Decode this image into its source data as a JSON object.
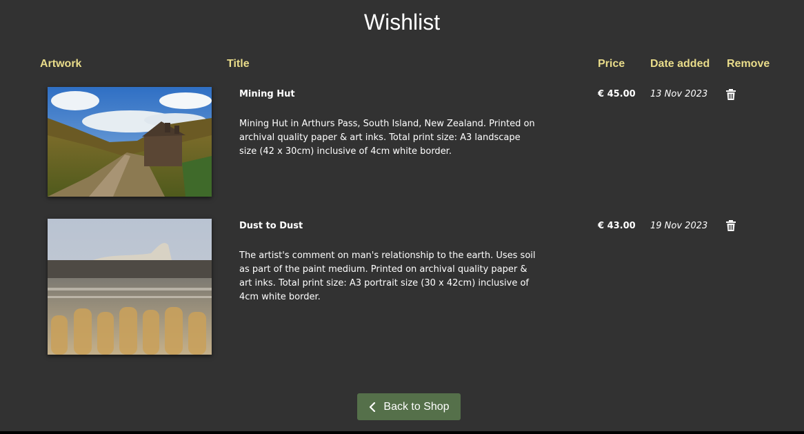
{
  "page": {
    "title": "Wishlist"
  },
  "columns": {
    "artwork": "Artwork",
    "title": "Title",
    "price": "Price",
    "date_added": "Date added",
    "remove": "Remove"
  },
  "items": [
    {
      "title": "Mining Hut",
      "description": "Mining Hut in Arthurs Pass, South Island, New Zealand. Printed on archival quality paper & art inks. Total print size: A3 landscape size (42 x 30cm) inclusive of 4cm white border.",
      "price": "€ 45.00",
      "date": "13 Nov 2023",
      "remove_icon": "trash-icon"
    },
    {
      "title": "Dust to Dust",
      "description": "The artist's comment on man's relationship to the earth. Uses soil as part of the paint medium. Printed on archival quality paper & art inks. Total print size: A3 portrait size (30 x 42cm) inclusive of 4cm white border.",
      "price": "€ 43.00",
      "date": "19 Nov 2023",
      "remove_icon": "trash-icon"
    }
  ],
  "footer": {
    "back_label": "Back to Shop",
    "back_icon": "chevron-left-icon"
  },
  "colors": {
    "background": "#323232",
    "header_accent": "#e9dc8a",
    "button": "#55704a"
  }
}
